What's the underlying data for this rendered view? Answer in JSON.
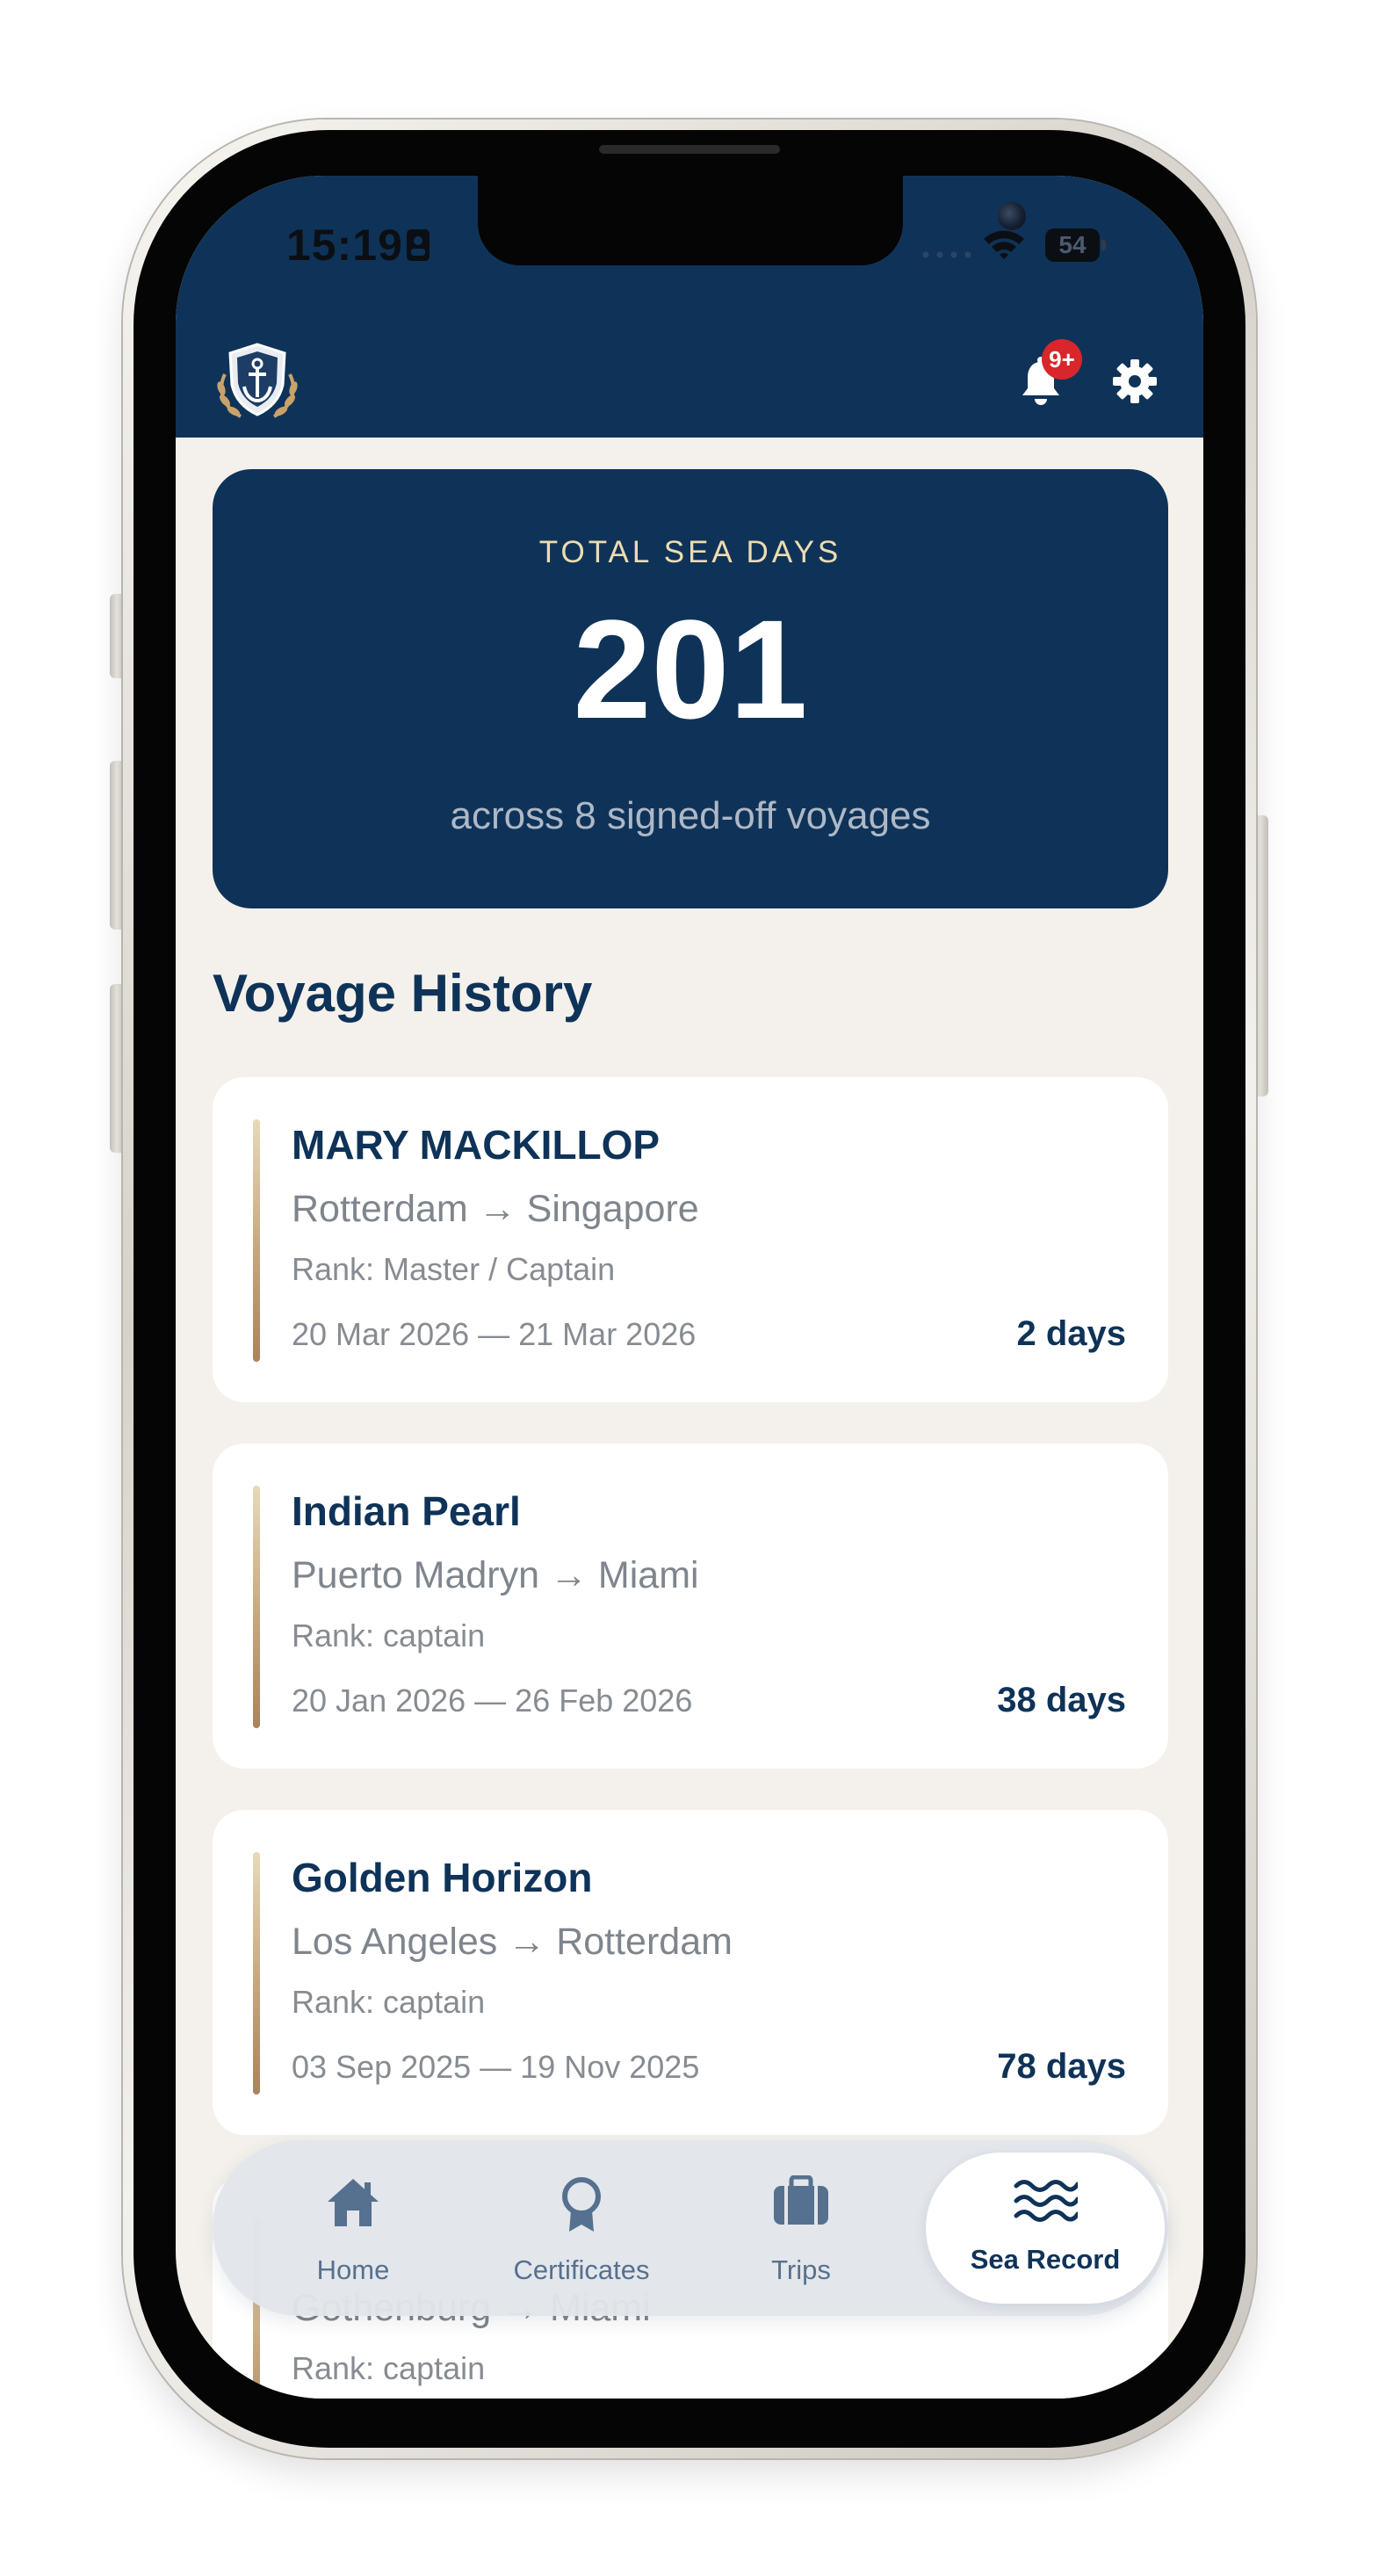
{
  "status_bar": {
    "time": "15:19",
    "battery": "54"
  },
  "header": {
    "logo_icon": "anchor-shield-logo",
    "notification_badge": "9+",
    "notification_icon": "bell-icon",
    "settings_icon": "gear-icon"
  },
  "summary": {
    "label": "TOTAL SEA DAYS",
    "value": "201",
    "subtitle": "across 8 signed-off voyages"
  },
  "voyage_history": {
    "title": "Voyage History",
    "items": [
      {
        "vessel": "MARY MACKILLOP",
        "route": "Rotterdam → Singapore",
        "rank": "Rank: Master / Captain",
        "dates": "20 Mar 2026 — 21 Mar 2026",
        "days": "2 days"
      },
      {
        "vessel": "Indian Pearl",
        "route": "Puerto Madryn → Miami",
        "rank": "Rank: captain",
        "dates": "20 Jan 2026 — 26 Feb 2026",
        "days": "38 days"
      },
      {
        "vessel": "Golden Horizon",
        "route": "Los Angeles → Rotterdam",
        "rank": "Rank: captain",
        "dates": "03 Sep 2025 — 19 Nov 2025",
        "days": "78 days"
      },
      {
        "vessel": "",
        "route": "Gothenburg → Miami",
        "rank": "Rank: captain",
        "dates": "",
        "days": ""
      }
    ]
  },
  "tab_bar": {
    "tabs": [
      {
        "label": "Home",
        "icon": "house-icon",
        "active": false
      },
      {
        "label": "Certificates",
        "icon": "ribbon-award-icon",
        "active": false
      },
      {
        "label": "Trips",
        "icon": "briefcase-icon",
        "active": false
      },
      {
        "label": "Sea Record",
        "icon": "waves-icon",
        "active": true
      }
    ]
  },
  "colors": {
    "navy": "#0f3358",
    "background": "#f4f1ec",
    "gold_text": "#ecdcb0",
    "badge_red": "#d8262b",
    "muted_text": "#878c92"
  }
}
